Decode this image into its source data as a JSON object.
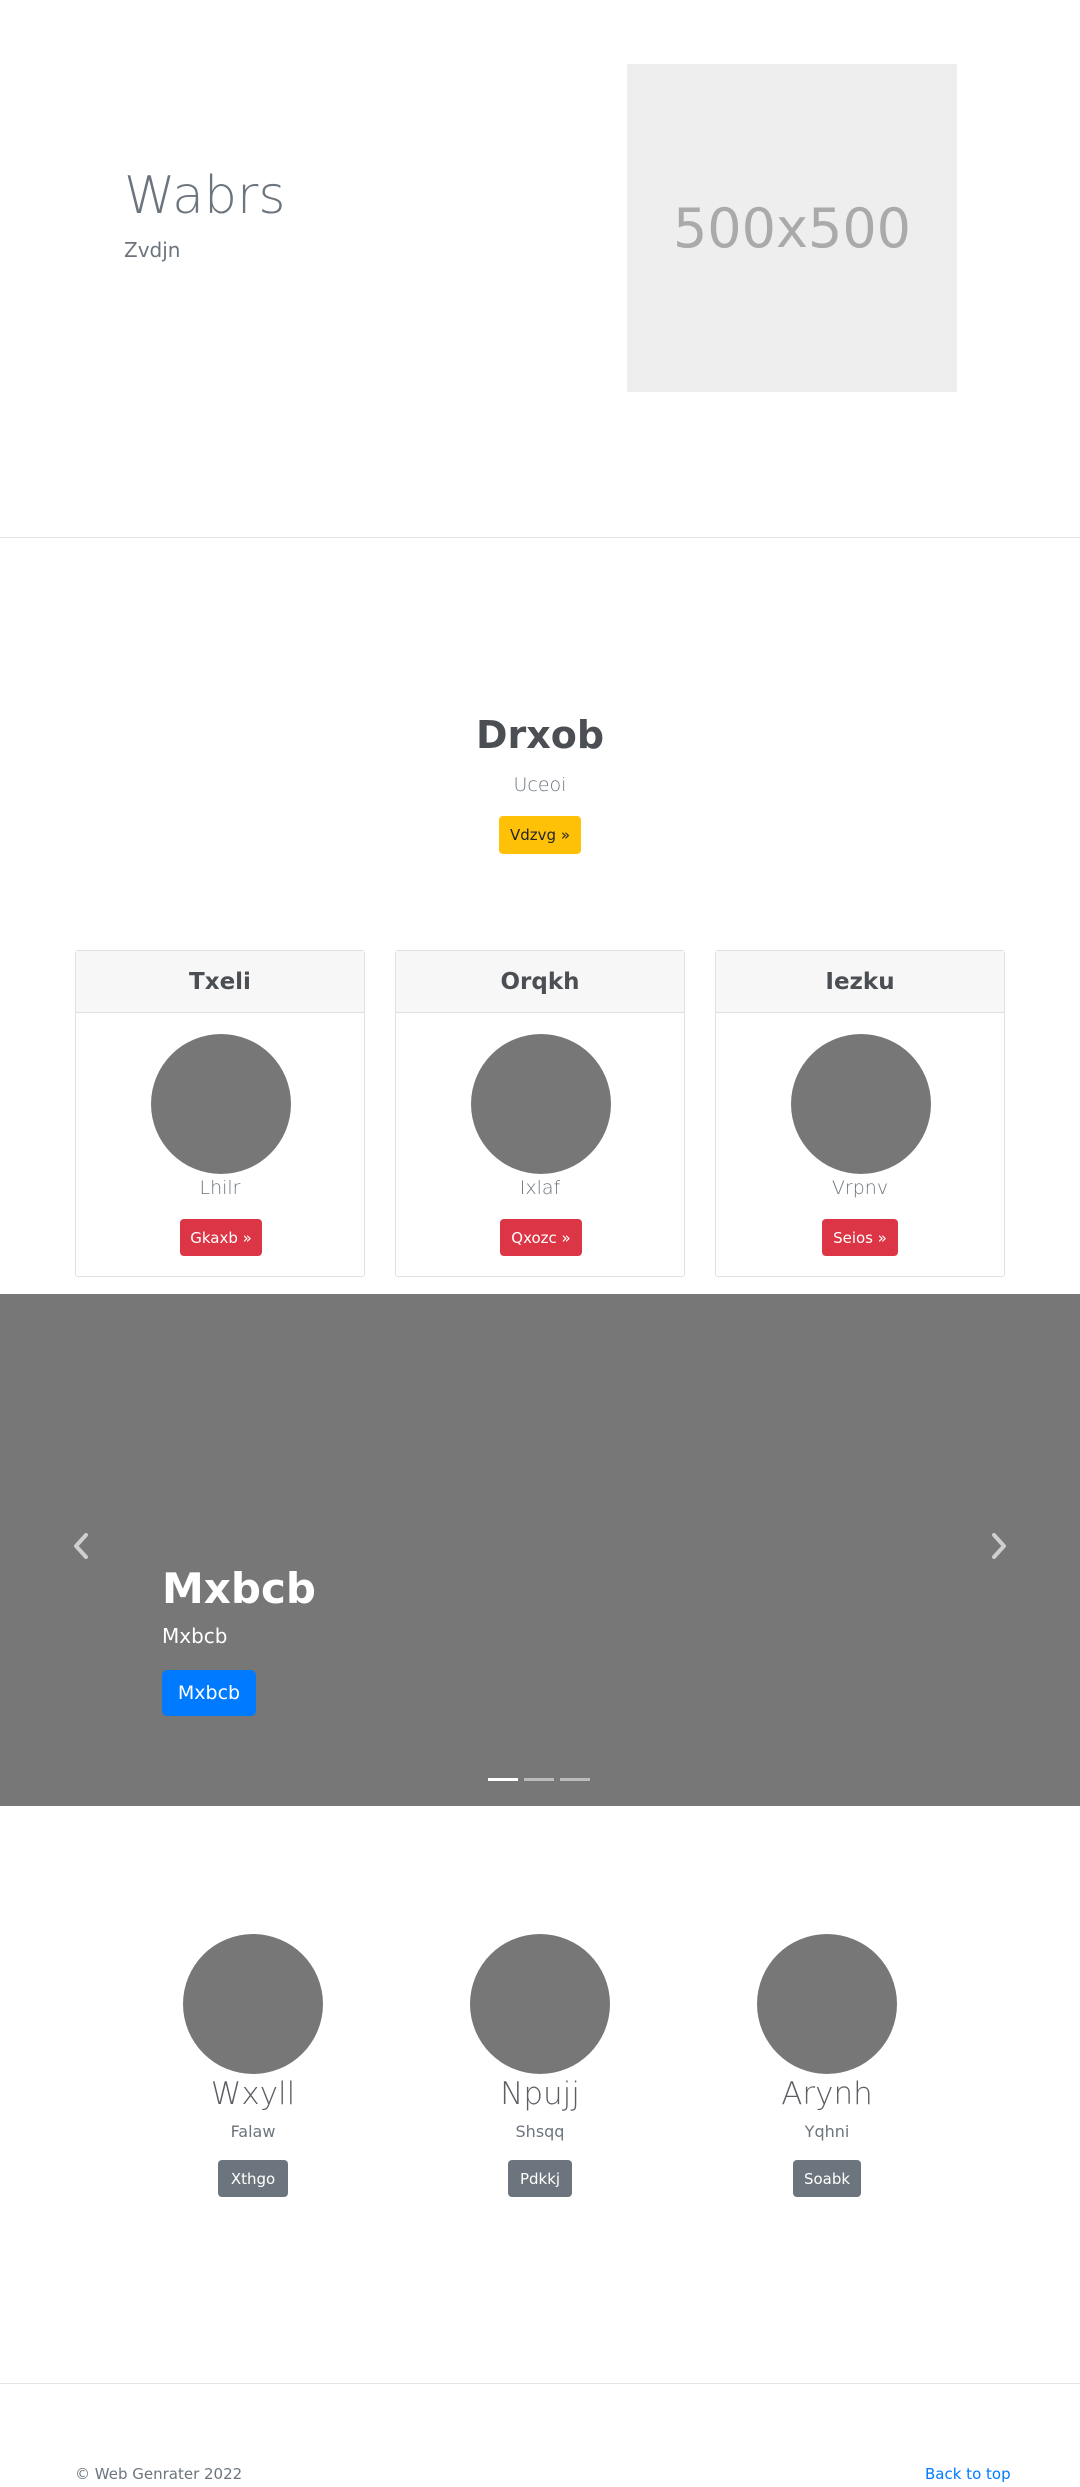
{
  "hero": {
    "title": "Wabrs",
    "subtitle": "Zvdjn",
    "image_placeholder": "500x500"
  },
  "intro": {
    "title": "Drxob",
    "subtitle": "Uceoi",
    "button_label": "Vdzvg »"
  },
  "cards": [
    {
      "header": "Txeli",
      "text": "Lhilr",
      "button_label": "Gkaxb »"
    },
    {
      "header": "Orqkh",
      "text": "Ixlaf",
      "button_label": "Qxozc »"
    },
    {
      "header": "Iezku",
      "text": "Vrpnv",
      "button_label": "Seios »"
    }
  ],
  "carousel": {
    "title": "Mxbcb",
    "subtitle": "Mxbcb",
    "button_label": "Mxbcb",
    "prev_icon": "chevron-left-icon",
    "next_icon": "chevron-right-icon",
    "slide_count": 3,
    "active_slide": 1
  },
  "team": [
    {
      "name": "Wxyll",
      "role": "Falaw",
      "button_label": "Xthgo"
    },
    {
      "name": "Npujj",
      "role": "Shsqq",
      "button_label": "Pdkkj"
    },
    {
      "name": "Arynh",
      "role": "Yqhni",
      "button_label": "Soabk"
    }
  ],
  "footer": {
    "copyright": "© Web Genrater 2022",
    "back_to_top": "Back to top"
  },
  "colors": {
    "warning": "#ffc107",
    "danger": "#dc3545",
    "primary": "#007bff",
    "secondary": "#6c757d",
    "placeholder": "#777777"
  }
}
